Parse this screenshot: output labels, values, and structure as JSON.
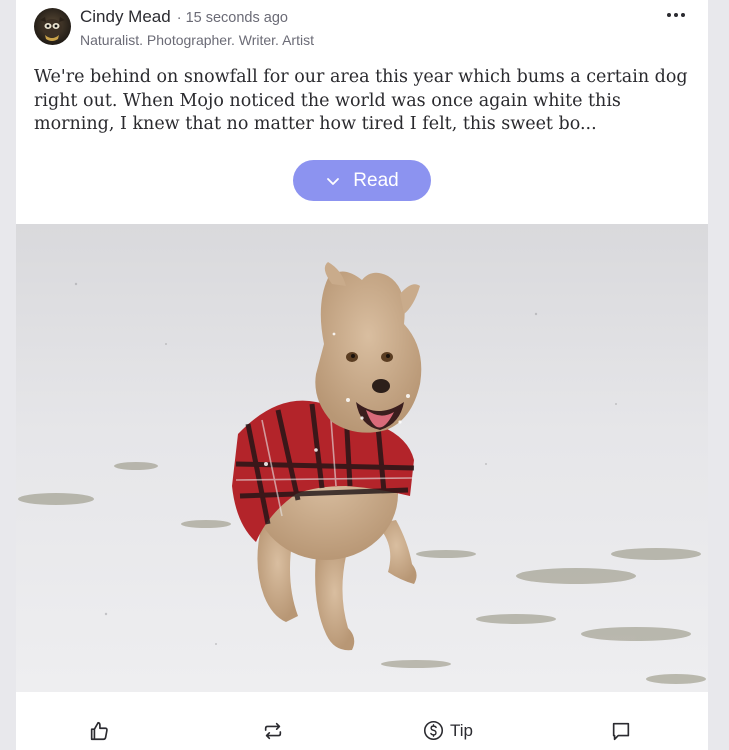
{
  "post": {
    "author_name": "Cindy Mead",
    "separator": "·",
    "timestamp": "15 seconds ago",
    "bio": "Naturalist. Photographer. Writer. Artist",
    "body_text": "We're behind on snowfall for our area this year which bums a certain dog right out. When Mojo noticed the world was once again white this morning, I knew that no matter how tired I felt, this sweet bo...",
    "read_label": "Read",
    "more_icon": "more-horizontal-icon",
    "read_icon": "chevron-down-icon"
  },
  "actions": {
    "like_icon": "thumbs-up-icon",
    "repost_icon": "repost-icon",
    "tip_icon": "dollar-circle-icon",
    "tip_label": "Tip",
    "comment_icon": "comment-icon"
  },
  "colors": {
    "read_button_bg": "#8c93f0",
    "text": "#2b2b30",
    "muted": "#6b6b76",
    "card_bg": "#ffffff",
    "page_bg": "#e8e8ec"
  }
}
